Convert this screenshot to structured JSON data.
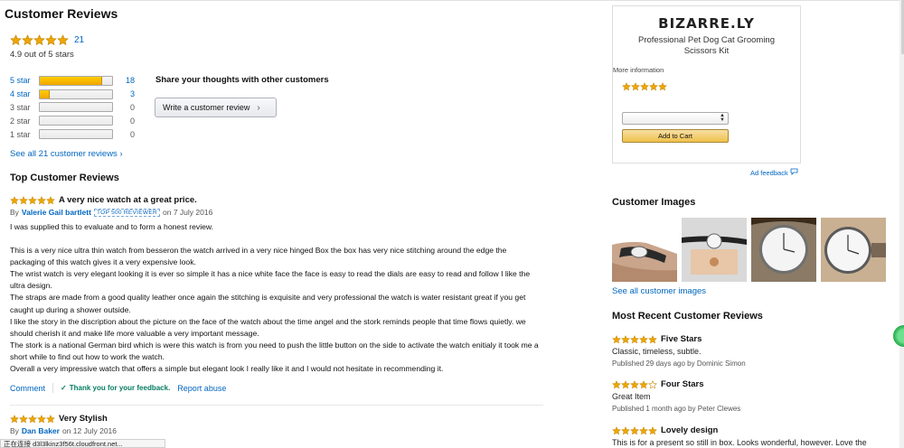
{
  "colors": {
    "star": "#f0a600",
    "link": "#0066c0",
    "green_check": "#067d62"
  },
  "header": {
    "title": "Customer Reviews"
  },
  "summary": {
    "rating_count": "21",
    "out_of": "4.9 out of 5 stars",
    "stars": 4.9
  },
  "histogram": [
    {
      "label": "5 star",
      "count": "18",
      "fraction": 0.857,
      "link": true
    },
    {
      "label": "4 star",
      "count": "3",
      "fraction": 0.143,
      "link": true
    },
    {
      "label": "3 star",
      "count": "0",
      "fraction": 0,
      "link": false
    },
    {
      "label": "2 star",
      "count": "0",
      "fraction": 0,
      "link": false
    },
    {
      "label": "1 star",
      "count": "0",
      "fraction": 0,
      "link": false
    }
  ],
  "share": {
    "text": "Share your thoughts with other customers",
    "button": "Write a customer review"
  },
  "see_all": "See all 21 customer reviews ›",
  "top_reviews": {
    "heading": "Top Customer Reviews",
    "reviews": [
      {
        "title": "A very nice watch at a great price.",
        "by_prefix": "By",
        "author": "Valerie Gail bartlett",
        "badge": "TOP 500 REVIEWER",
        "date": "on 7 July 2016",
        "body": [
          "I was supplied this to evaluate and to form a honest review.",
          "",
          "This is a very nice ultra thin watch from besseron the watch arrived in a very nice hinged Box the box has very nice stitching around the edge the packaging of this watch gives it a very expensive look.",
          "The wrist watch is very elegant looking it is ever so simple it has a nice white face the face is easy to read the dials are easy to read and follow I like the ultra design.",
          "The straps are made from a good quality leather once again the stitching is exquisite and very professional the watch is water resistant great if you get caught up during a shower outside.",
          "I like the story in the discription about the picture on the face of the watch about the time angel and the stork reminds people that time flows quietly. we should cherish it and make life more valuable a very important message.",
          "The stork is a national German bird which is were this watch is from you need to push the little button on the side to activate the watch enitialy it took me a short while to find out how to work the watch.",
          "Overall a very impressive watch that offers a simple but elegant look I really like it and I would not hesitate in recommending it."
        ],
        "actions": {
          "comment": "Comment",
          "thanks": "Thank you for your feedback.",
          "report": "Report abuse"
        }
      },
      {
        "title": "Very Stylish",
        "by_prefix": "By",
        "author": "Dan Baker",
        "date": "on 12 July 2016"
      }
    ]
  },
  "status_bar": {
    "text": "正在连接 d3l3lkinz3f56t.cloudfront.net..."
  },
  "ad": {
    "brand": "BIZARRE.LY",
    "description": "Professional Pet Dog Cat Grooming Scissors Kit",
    "more_info": "More information",
    "cart_button": "Add to Cart",
    "feedback": "Ad feedback"
  },
  "customer_images": {
    "heading": "Customer Images",
    "see_all": "See all customer images"
  },
  "recent": {
    "heading": "Most Recent Customer Reviews",
    "items": [
      {
        "title": "Five Stars",
        "stars": 5,
        "text": "Classic, timeless, subtle.",
        "meta": "Published 29 days ago by Dominic Simon"
      },
      {
        "title": "Four Stars",
        "stars": 4,
        "text": "Great Item",
        "meta": "Published 1 month ago by Peter Clewes"
      },
      {
        "title": "Lovely design",
        "stars": 5,
        "text": "This is for a present so still in box. Looks wonderful, however. Love the"
      }
    ]
  }
}
